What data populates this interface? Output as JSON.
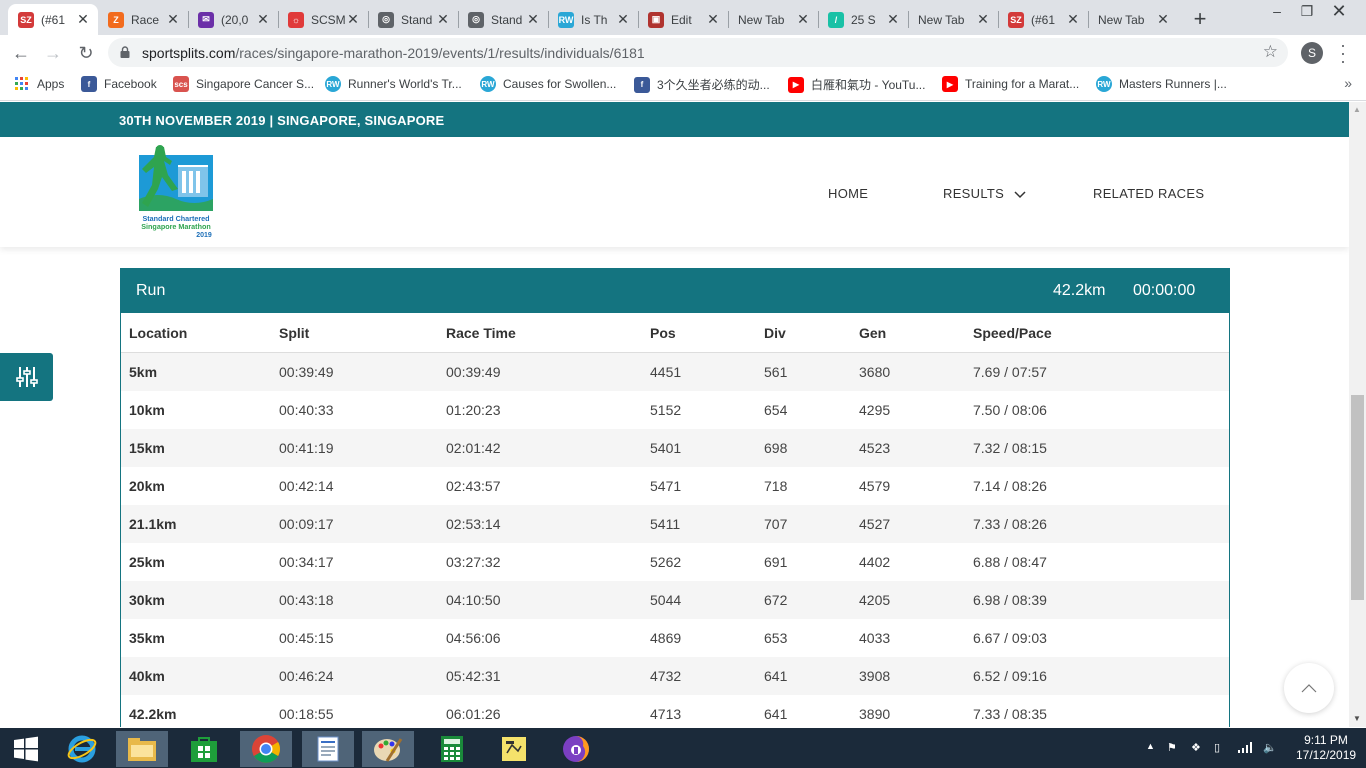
{
  "browser": {
    "tabs": [
      {
        "title": "(#61",
        "favicon": "SZ",
        "color": "#d33a3a",
        "active": true
      },
      {
        "title": "Race",
        "favicon": "Z",
        "color": "#f26b1d",
        "active": false
      },
      {
        "title": "(20,0",
        "favicon": "✉",
        "color": "#6b2fa8",
        "active": false
      },
      {
        "title": "SCSM",
        "favicon": "☼",
        "color": "#e03a3a",
        "active": false
      },
      {
        "title": "Stand",
        "favicon": "◎",
        "color": "#5f6368",
        "active": false
      },
      {
        "title": "Stand",
        "favicon": "◎",
        "color": "#5f6368",
        "active": false
      },
      {
        "title": "Is Th",
        "favicon": "RW",
        "color": "#2aa7d6",
        "active": false
      },
      {
        "title": "Edit",
        "favicon": "▣",
        "color": "#b0332f",
        "active": false
      },
      {
        "title": "New Tab",
        "favicon": "",
        "color": "",
        "active": false
      },
      {
        "title": "25 S",
        "favicon": "/",
        "color": "#19c1a6",
        "active": false
      },
      {
        "title": "New Tab",
        "favicon": "",
        "color": "",
        "active": false
      },
      {
        "title": "(#61",
        "favicon": "SZ",
        "color": "#d33a3a",
        "active": false
      },
      {
        "title": "New Tab",
        "favicon": "",
        "color": "",
        "active": false
      }
    ],
    "url_domain": "sportsplits.com",
    "url_path": "/races/singapore-marathon-2019/events/1/results/individuals/6181",
    "profile_initial": "S",
    "bookmarks": [
      {
        "label": "Apps",
        "icon": "apps-grid-icon",
        "color": "#4285f4"
      },
      {
        "label": "Facebook",
        "icon": "f",
        "color": "#3b5998"
      },
      {
        "label": "Singapore Cancer S...",
        "icon": "scs",
        "color": "#d9534f"
      },
      {
        "label": "Runner's World's Tr...",
        "icon": "RW",
        "color": "#2aa7d6"
      },
      {
        "label": "Causes for Swollen...",
        "icon": "RW",
        "color": "#2aa7d6"
      },
      {
        "label": "3个久坐者必练的动...",
        "icon": "f",
        "color": "#3b5998"
      },
      {
        "label": "白雁和氣功 - YouTu...",
        "icon": "▶",
        "color": "#ff0000"
      },
      {
        "label": "Training for a Marat...",
        "icon": "▶",
        "color": "#ff0000"
      },
      {
        "label": "Masters Runners |...",
        "icon": "RW",
        "color": "#2aa7d6"
      }
    ]
  },
  "page": {
    "event_banner": "30TH NOVEMBER 2019 | SINGAPORE, SINGAPORE",
    "logo_text_1": "Standard Chartered",
    "logo_text_2": "Singapore Marathon",
    "logo_text_3": "2019",
    "nav": {
      "home": "HOME",
      "results": "RESULTS",
      "related": "RELATED RACES"
    },
    "accent_color": "#147480"
  },
  "splits": {
    "title": "Run",
    "distance": "42.2km",
    "total_time": "00:00:00",
    "columns": [
      "Location",
      "Split",
      "Race Time",
      "Pos",
      "Div",
      "Gen",
      "Speed/Pace"
    ],
    "rows": [
      [
        "5km",
        "00:39:49",
        "00:39:49",
        "4451",
        "561",
        "3680",
        "7.69 / 07:57"
      ],
      [
        "10km",
        "00:40:33",
        "01:20:23",
        "5152",
        "654",
        "4295",
        "7.50 / 08:06"
      ],
      [
        "15km",
        "00:41:19",
        "02:01:42",
        "5401",
        "698",
        "4523",
        "7.32 / 08:15"
      ],
      [
        "20km",
        "00:42:14",
        "02:43:57",
        "5471",
        "718",
        "4579",
        "7.14 / 08:26"
      ],
      [
        "21.1km",
        "00:09:17",
        "02:53:14",
        "5411",
        "707",
        "4527",
        "7.33 / 08:26"
      ],
      [
        "25km",
        "00:34:17",
        "03:27:32",
        "5262",
        "691",
        "4402",
        "6.88 / 08:47"
      ],
      [
        "30km",
        "00:43:18",
        "04:10:50",
        "5044",
        "672",
        "4205",
        "6.98 / 08:39"
      ],
      [
        "35km",
        "00:45:15",
        "04:56:06",
        "4869",
        "653",
        "4033",
        "6.67 / 09:03"
      ],
      [
        "40km",
        "00:46:24",
        "05:42:31",
        "4732",
        "641",
        "3908",
        "6.52 / 09:16"
      ],
      [
        "42.2km",
        "00:18:55",
        "06:01:26",
        "4713",
        "641",
        "3890",
        "7.33 / 08:35"
      ]
    ]
  },
  "taskbar": {
    "time": "9:11 PM",
    "date": "17/12/2019"
  }
}
